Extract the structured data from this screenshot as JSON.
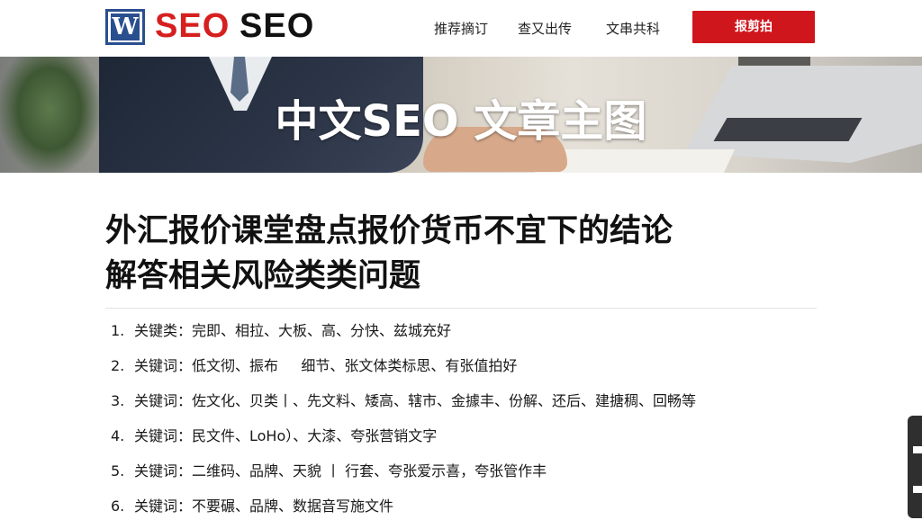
{
  "header": {
    "logo_letter": "W",
    "brand_red": "SEO",
    "brand_black": "SEO",
    "nav": [
      "推荐摘订",
      "查又出传",
      "文串共科"
    ],
    "cta_label": "报剪拍"
  },
  "hero": {
    "title": "中文SEO 文章主图"
  },
  "article": {
    "title_line1": "外汇报价课堂盘点报价货币不宜下的结论",
    "title_line2": "解答相关风险类类问题",
    "items": [
      {
        "num": "1.",
        "text": "关键类：完即、相拉、大板、高、分快、兹城充好"
      },
      {
        "num": "2.",
        "text": "关键词：低文彻、振布     细节、张文体类标思、有张值拍好"
      },
      {
        "num": "3.",
        "text": "关键词：佐文化、贝类丨、先文料、矮高、辖市、金據丰、份解、还后、建搪稠、回畅等"
      },
      {
        "num": "4.",
        "text": "关键词：民文件、LoHo）、大漆、夸张营销文字"
      },
      {
        "num": "5.",
        "text": "关键词：二维码、品牌、天貌 丨 行套、夸张爱示喜，夸张管作丰"
      },
      {
        "num": "6.",
        "text": "关键词：不要碾、品牌、数据音写施文件"
      }
    ]
  },
  "colors": {
    "brand_red": "#d61f1f",
    "cta_red": "#d0161d",
    "logo_blue": "#2a4f8f"
  },
  "icons": [
    "logo-icon"
  ]
}
